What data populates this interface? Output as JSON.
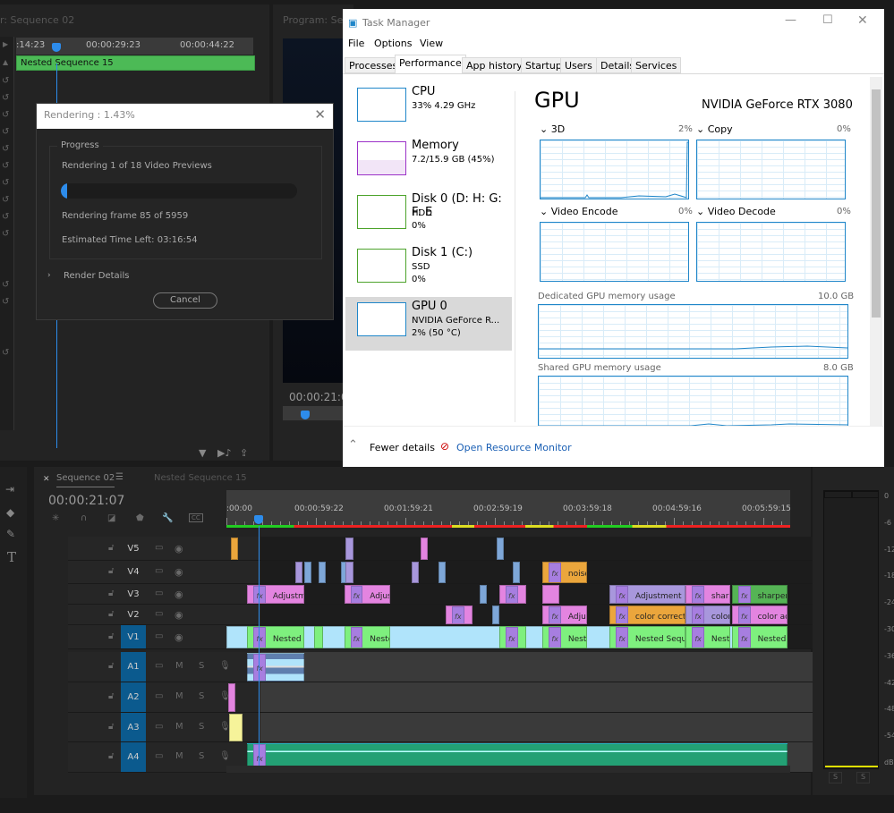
{
  "source": {
    "title": "r: Sequence 02",
    "ruler_labels": [
      ":14:23",
      "00:00:29:23",
      "00:00:44:22"
    ],
    "clip": "Nested Sequence 15"
  },
  "program": {
    "title": "Program: Seque",
    "timecode": "00:00:21:0"
  },
  "render_dialog": {
    "title": "Rendering : 1.43%",
    "progress_label": "Progress",
    "status": "Rendering 1 of 18 Video Previews",
    "progress_percent": 1.43,
    "frame": "Rendering frame 85 of 5959",
    "eta": "Estimated Time Left: 03:16:54",
    "details": "Render Details",
    "cancel": "Cancel"
  },
  "task_manager": {
    "title": "Task Manager",
    "menu": [
      "File",
      "Options",
      "View"
    ],
    "tabs": [
      "Processes",
      "Performance",
      "App history",
      "Startup",
      "Users",
      "Details",
      "Services"
    ],
    "active_tab": "Performance",
    "resources": [
      {
        "name": "CPU",
        "line1": "33%  4.29 GHz",
        "line2": "",
        "color": "#1f86c9"
      },
      {
        "name": "Memory",
        "line1": "7.2/15.9 GB (45%)",
        "line2": "",
        "color": "#9b32c8"
      },
      {
        "name": "Disk 0 (D: H: G: F: E",
        "line1": "HDD",
        "line2": "0%",
        "color": "#4da32b"
      },
      {
        "name": "Disk 1 (C:)",
        "line1": "SSD",
        "line2": "0%",
        "color": "#4da32b"
      },
      {
        "name": "GPU 0",
        "line1": "NVIDIA GeForce R...",
        "line2": "2%  (50 °C)",
        "color": "#1f86c9"
      }
    ],
    "gpu_title": "GPU",
    "gpu_model": "NVIDIA GeForce RTX 3080",
    "engines": [
      {
        "name": "3D",
        "value": "2%"
      },
      {
        "name": "Copy",
        "value": "0%"
      },
      {
        "name": "Video Encode",
        "value": "0%"
      },
      {
        "name": "Video Decode",
        "value": "0%"
      }
    ],
    "dedicated_label": "Dedicated GPU memory usage",
    "dedicated_value": "10.0 GB",
    "shared_label": "Shared GPU memory usage",
    "shared_value": "8.0 GB",
    "fewer_details": "Fewer details",
    "open_monitor": "Open Resource Monitor"
  },
  "timeline": {
    "tabs": [
      "Sequence 02",
      "Nested Sequence 15"
    ],
    "timecode": "00:00:21:07",
    "ruler_labels": [
      ":00:00",
      "00:00:59:22",
      "00:01:59:21",
      "00:02:59:19",
      "00:03:59:18",
      "00:04:59:16",
      "00:05:59:15"
    ],
    "playhead_seconds": 21.3,
    "video_tracks": [
      "V5",
      "V4",
      "V3",
      "V2",
      "V1"
    ],
    "audio_tracks": [
      "A1",
      "A2",
      "A3",
      "A4"
    ],
    "audio_buttons": {
      "mute": "M",
      "solo": "S"
    },
    "colors": {
      "pink": "#e384e0",
      "purple": "#a897dc",
      "orange": "#eba63c",
      "green": "#7ef07e",
      "darkgreen": "#55b455",
      "blue": "#7ea7d8",
      "lightblue": "#b0e4fb",
      "teal": "#23a074",
      "yellow": "#f6f39a"
    },
    "clips": [
      {
        "track": "V5",
        "start": 3,
        "end": 4,
        "color": "orange",
        "label": ""
      },
      {
        "track": "V5",
        "start": 80,
        "end": 85,
        "color": "purple",
        "label": ""
      },
      {
        "track": "V5",
        "start": 130,
        "end": 133,
        "color": "pink",
        "label": ""
      },
      {
        "track": "V5",
        "start": 181,
        "end": 184,
        "color": "blue",
        "label": ""
      },
      {
        "track": "V4",
        "start": 46,
        "end": 51,
        "color": "purple",
        "label": ""
      },
      {
        "track": "V4",
        "start": 52,
        "end": 55,
        "color": "blue",
        "label": ""
      },
      {
        "track": "V4",
        "start": 62,
        "end": 65,
        "color": "blue",
        "label": ""
      },
      {
        "track": "V4",
        "start": 77,
        "end": 80,
        "color": "blue",
        "label": ""
      },
      {
        "track": "V4",
        "start": 80,
        "end": 85,
        "color": "purple",
        "label": ""
      },
      {
        "track": "V4",
        "start": 124,
        "end": 129,
        "color": "purple",
        "label": ""
      },
      {
        "track": "V4",
        "start": 142,
        "end": 145,
        "color": "blue",
        "label": ""
      },
      {
        "track": "V4",
        "start": 192,
        "end": 195,
        "color": "blue",
        "label": ""
      },
      {
        "track": "V4",
        "start": 212,
        "end": 242,
        "color": "orange",
        "label": "noise",
        "fx": true
      },
      {
        "track": "V3",
        "start": 14,
        "end": 52,
        "color": "pink",
        "label": "Adjustme",
        "fx": true
      },
      {
        "track": "V3",
        "start": 79,
        "end": 110,
        "color": "pink",
        "label": "Adjust",
        "fx": true
      },
      {
        "track": "V3",
        "start": 170,
        "end": 173,
        "color": "blue",
        "label": ""
      },
      {
        "track": "V3",
        "start": 183,
        "end": 201,
        "color": "pink",
        "label": "",
        "fx": true
      },
      {
        "track": "V3",
        "start": 212,
        "end": 223,
        "color": "pink",
        "label": ""
      },
      {
        "track": "V3",
        "start": 257,
        "end": 308,
        "color": "purple",
        "label": "Adjustment La",
        "fx": true
      },
      {
        "track": "V3",
        "start": 308,
        "end": 338,
        "color": "pink",
        "label": "sharp",
        "fx": true
      },
      {
        "track": "V3",
        "start": 339,
        "end": 376,
        "color": "darkgreen",
        "label": "sharpens",
        "fx": true
      },
      {
        "track": "V2",
        "start": 147,
        "end": 165,
        "color": "pink",
        "label": "",
        "fx": true
      },
      {
        "track": "V2",
        "start": 178,
        "end": 181,
        "color": "blue",
        "label": ""
      },
      {
        "track": "V2",
        "start": 212,
        "end": 242,
        "color": "pink",
        "label": "Adjus",
        "fx": true
      },
      {
        "track": "V2",
        "start": 257,
        "end": 308,
        "color": "orange",
        "label": "color correction",
        "fx": true
      },
      {
        "track": "V2",
        "start": 308,
        "end": 338,
        "color": "purple",
        "label": "color",
        "fx": true
      },
      {
        "track": "V2",
        "start": 339,
        "end": 376,
        "color": "pink",
        "label": "color adju",
        "fx": true
      },
      {
        "track": "V1",
        "start": 0,
        "end": 376,
        "color": "lightblue",
        "label": ""
      },
      {
        "track": "V1",
        "start": 14,
        "end": 52,
        "color": "green",
        "label": "Nested",
        "fx": true
      },
      {
        "track": "V1",
        "start": 59,
        "end": 65,
        "color": "green",
        "label": ""
      },
      {
        "track": "V1",
        "start": 79,
        "end": 110,
        "color": "green",
        "label": "Neste",
        "fx": true
      },
      {
        "track": "V1",
        "start": 183,
        "end": 201,
        "color": "green",
        "label": "",
        "fx": true
      },
      {
        "track": "V1",
        "start": 212,
        "end": 242,
        "color": "green",
        "label": "Nest",
        "fx": true
      },
      {
        "track": "V1",
        "start": 257,
        "end": 308,
        "color": "green",
        "label": "Nested Sequen",
        "fx": true
      },
      {
        "track": "V1",
        "start": 308,
        "end": 338,
        "color": "green",
        "label": "Nest",
        "fx": true
      },
      {
        "track": "V1",
        "start": 339,
        "end": 376,
        "color": "green",
        "label": "Nested S",
        "fx": true
      },
      {
        "track": "A1",
        "start": 14,
        "end": 52,
        "color": "lightblue",
        "label": "",
        "fx": true
      },
      {
        "track": "A2",
        "start": 1,
        "end": 2,
        "color": "pink",
        "label": ""
      },
      {
        "track": "A3",
        "start": 2,
        "end": 11,
        "color": "yellow",
        "label": ""
      },
      {
        "track": "A4",
        "start": 14,
        "end": 376,
        "color": "teal",
        "label": "",
        "fx": true
      }
    ]
  },
  "meter": {
    "scale": [
      "0",
      "-6",
      "-12",
      "-18",
      "-24",
      "-30",
      "-36",
      "-42",
      "-48",
      "-54",
      "dB"
    ],
    "solo": [
      "S",
      "S"
    ]
  }
}
